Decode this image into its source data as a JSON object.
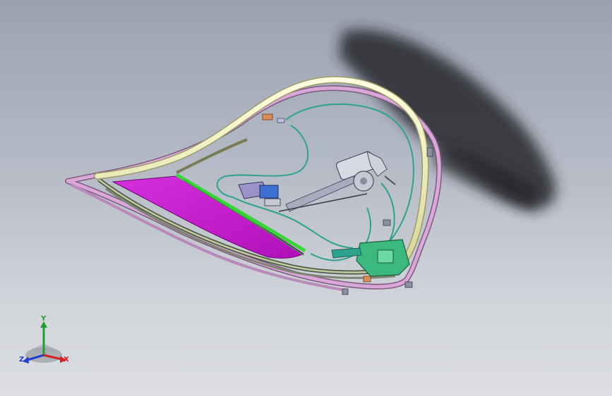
{
  "viewport": {
    "background_top": "#9aa2b1",
    "background_bottom": "#dcdee2"
  },
  "model": {
    "colors": {
      "trim_seal": "#ecebb4",
      "trim_seal_edge": "#9c9b6a",
      "door_frame": "#d9a8d9",
      "door_frame_edge": "#7e5a80",
      "glass_panel": "#c218c8",
      "glass_edge_strip": "#39d43a",
      "wire_harness": "#2fa28f",
      "regulator_rail": "#a9acbe",
      "window_motor": "#d7d9e4",
      "latch_module": "#3bb87d",
      "shadow": "#1f2126"
    }
  },
  "triad": {
    "y_label": "Y",
    "x_label": "X",
    "z_label": "Z",
    "y_color": "#1e9e2e",
    "x_color": "#d42020",
    "z_color": "#2040d0"
  }
}
